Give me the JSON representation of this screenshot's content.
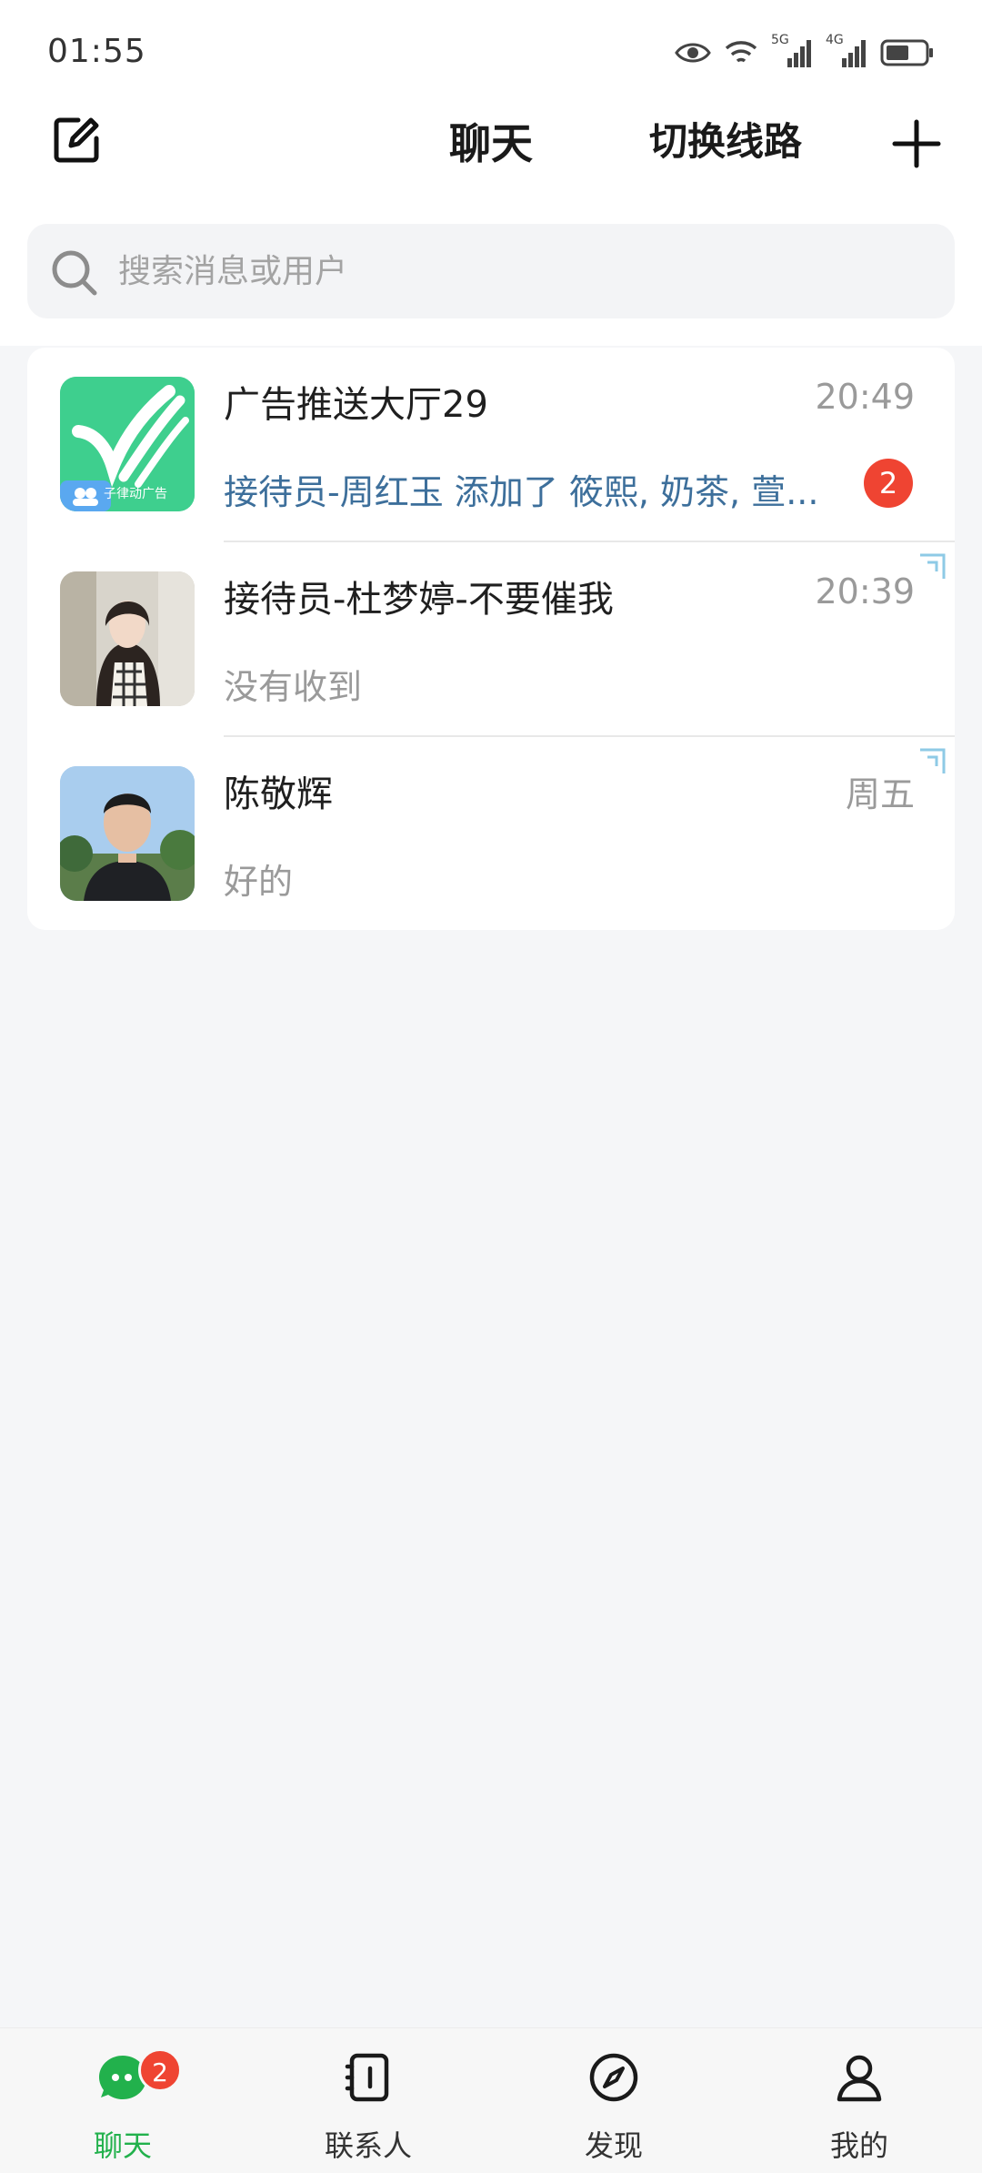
{
  "status_bar": {
    "time": "01:55",
    "signal_1_label": "5G",
    "signal_2_label": "4G",
    "icons": [
      "eye-icon",
      "wifi-icon",
      "signal-5g-icon",
      "signal-4g-icon",
      "battery-icon"
    ]
  },
  "header": {
    "title": "聊天",
    "switch_route": "切换线路",
    "compose_icon": "compose-icon",
    "add_icon": "plus-icon"
  },
  "search": {
    "placeholder": "搜索消息或用户",
    "value": ""
  },
  "chats": [
    {
      "name": "广告推送大厅29",
      "time": "20:49",
      "preview": "接待员-周红玉 添加了 筱熙, 奶茶, 萱...",
      "unread": "2",
      "avatar_text": "子律动广告",
      "pinned": false
    },
    {
      "name": "接待员-杜梦婷-不要催我",
      "time": "20:39",
      "preview": "没有收到",
      "pinned": true
    },
    {
      "name": "陈敬辉",
      "time": "周五",
      "preview": "好的",
      "pinned": true
    }
  ],
  "tabs": [
    {
      "label": "聊天",
      "icon": "chat-icon",
      "active": true,
      "badge": "2"
    },
    {
      "label": "联系人",
      "icon": "contacts-icon",
      "active": false
    },
    {
      "label": "发现",
      "icon": "compass-icon",
      "active": false
    },
    {
      "label": "我的",
      "icon": "profile-icon",
      "active": false
    }
  ],
  "colors": {
    "accent_green": "#22b14c",
    "badge_red": "#ef4432",
    "highlight_blue": "#3d6f9b",
    "background": "#f5f6f8"
  }
}
